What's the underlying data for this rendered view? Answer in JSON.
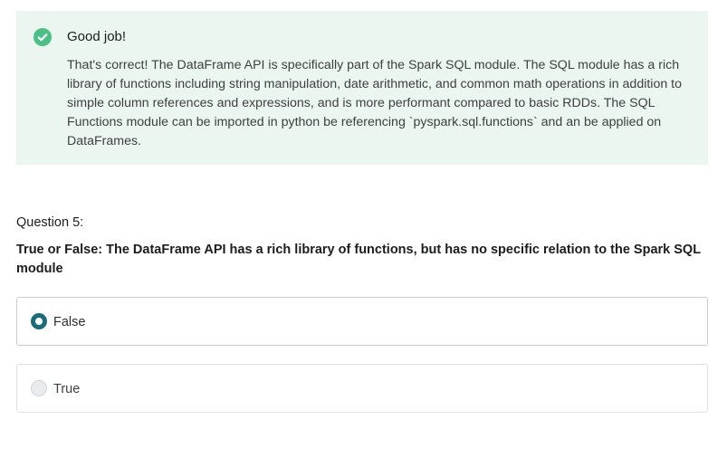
{
  "feedback": {
    "icon": "check-circle-icon",
    "icon_color": "#4bbf86",
    "background": "#eaf6ef",
    "title": "Good job!",
    "body": "That's correct! The DataFrame API is specifically part of the Spark SQL module. The SQL module has a rich library of functions including string manipulation, date arithmetic, and common math operations in addition to simple column references and expressions, and is more performant compared to basic RDDs. The SQL Functions module can be imported in python be referencing `pyspark.sql.functions` and an be applied on DataFrames."
  },
  "question": {
    "number_label": "Question 5:",
    "prompt": "True or False: The DataFrame API has a rich library of functions, but has no specific relation to the Spark SQL module",
    "answers": [
      {
        "label": "False",
        "selected": true
      },
      {
        "label": "True",
        "selected": false
      }
    ],
    "selected_color": "#1c6b7a"
  }
}
